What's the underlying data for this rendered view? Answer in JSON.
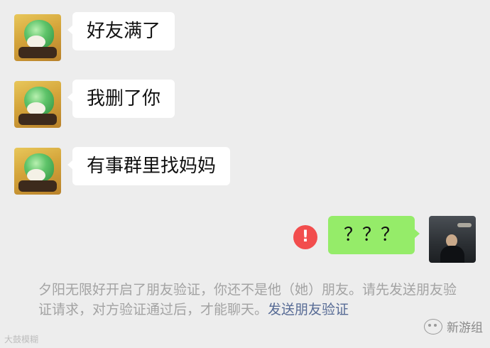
{
  "messages": [
    {
      "side": "left",
      "text": "好友满了"
    },
    {
      "side": "left",
      "text": "我删了你"
    },
    {
      "side": "left",
      "text": "有事群里找妈妈"
    },
    {
      "side": "right",
      "text": "？？？",
      "status": "failed"
    }
  ],
  "error_icon_glyph": "!",
  "system_note": {
    "text": "夕阳无限好开启了朋友验证，你还不是他（她）朋友。请先发送朋友验证请求，对方验证通过后，才能聊天。",
    "link": "发送朋友验证"
  },
  "watermarks": {
    "left": "大鼓模糊",
    "right": "新游组"
  },
  "colors": {
    "background": "#ededed",
    "received_bubble": "#ffffff",
    "sent_bubble": "#95ec69",
    "error": "#f24d4d",
    "system_text": "#a3a3a3",
    "link": "#576b95"
  }
}
